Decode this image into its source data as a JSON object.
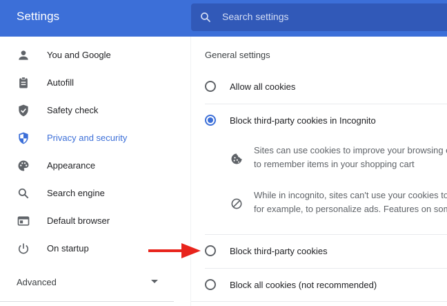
{
  "header": {
    "title": "Settings",
    "search_placeholder": "Search settings"
  },
  "sidebar": {
    "items": [
      {
        "label": "You and Google",
        "icon": "person-icon"
      },
      {
        "label": "Autofill",
        "icon": "clipboard-icon"
      },
      {
        "label": "Safety check",
        "icon": "shield-check-icon"
      },
      {
        "label": "Privacy and security",
        "icon": "shield-icon",
        "active": true
      },
      {
        "label": "Appearance",
        "icon": "palette-icon"
      },
      {
        "label": "Search engine",
        "icon": "search-icon"
      },
      {
        "label": "Default browser",
        "icon": "browser-icon"
      },
      {
        "label": "On startup",
        "icon": "power-icon"
      }
    ],
    "advanced_label": "Advanced"
  },
  "main": {
    "section_title": "General settings",
    "options": {
      "allow_all": "Allow all cookies",
      "block_incognito": "Block third-party cookies in Incognito",
      "block_third_party": "Block third-party cookies",
      "block_all": "Block all cookies (not recommended)"
    },
    "selected_option": "block_incognito",
    "info": {
      "cookie_line1": "Sites can use cookies to improve your browsing e",
      "cookie_line2": "to remember items in your shopping cart",
      "block_line1": "While in incognito, sites can't use your cookies to",
      "block_line2": "for example, to personalize ads. Features on som"
    }
  },
  "colors": {
    "accent": "#3c6fd8",
    "header": "#3c6fd8",
    "search_bg": "#3159b8",
    "arrow": "#e8241c"
  }
}
